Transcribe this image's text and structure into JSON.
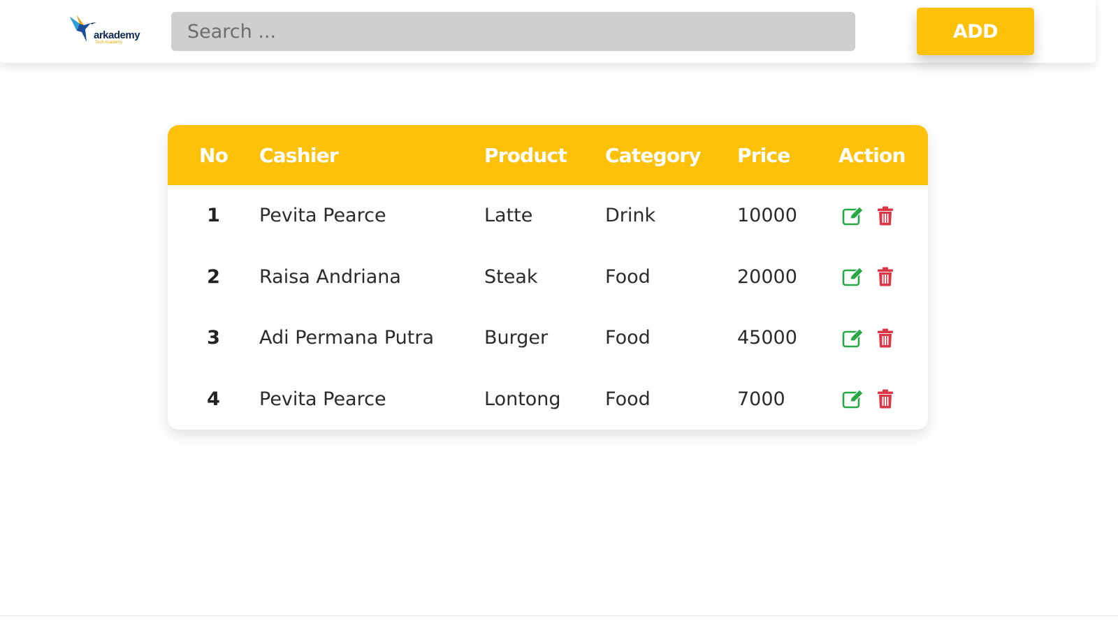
{
  "header": {
    "logo_text": "arkademy",
    "logo_subtext": "Tech Academy",
    "search_placeholder": "Search ...",
    "add_label": "ADD"
  },
  "table": {
    "columns": [
      "No",
      "Cashier",
      "Product",
      "Category",
      "Price",
      "Action"
    ],
    "rows": [
      {
        "no": "1",
        "cashier": "Pevita Pearce",
        "product": "Latte",
        "category": "Drink",
        "price": "10000"
      },
      {
        "no": "2",
        "cashier": "Raisa Andriana",
        "product": "Steak",
        "category": "Food",
        "price": "20000"
      },
      {
        "no": "3",
        "cashier": "Adi Permana Putra",
        "product": "Burger",
        "category": "Food",
        "price": "45000"
      },
      {
        "no": "4",
        "cashier": "Pevita Pearce",
        "product": "Lontong",
        "category": "Food",
        "price": "7000"
      }
    ],
    "row_actions": {
      "edit_icon": "edit-icon",
      "delete_icon": "trash-icon"
    }
  },
  "colors": {
    "accent": "#fdc10a",
    "edit": "#28a745",
    "delete": "#dc3545",
    "search_bg": "#cfcfcf"
  }
}
